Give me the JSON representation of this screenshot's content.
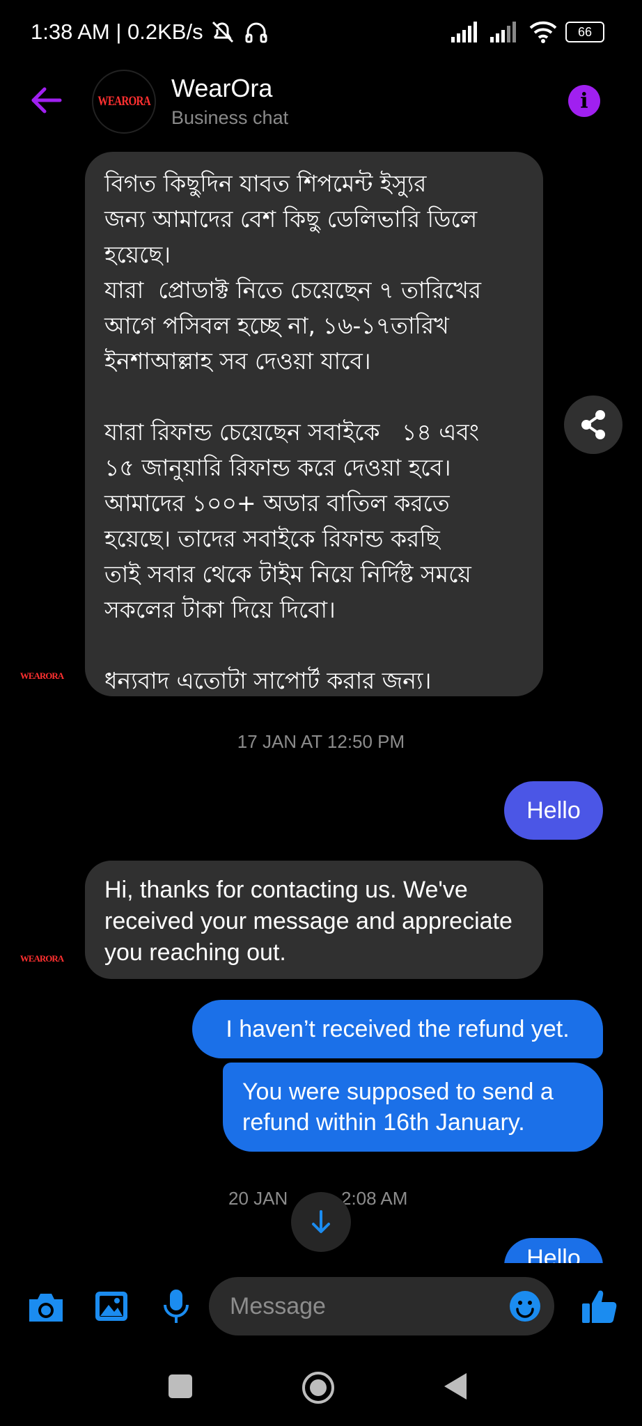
{
  "status_bar": {
    "time": "1:38 AM | 0.2KB/s",
    "battery": "66"
  },
  "header": {
    "title": "WearOra",
    "subtitle": "Business chat",
    "avatar_logo_text": "WEARORA"
  },
  "messages": {
    "bengali_notice": "বিগত কিছুদিন যাবত শিপমেন্ট ইস্যুর\nজন্য আমাদের বেশ কিছু ডেলিভারি ডিলে\nহয়েছে।\nযারা  প্রোডাক্ট নিতে চেয়েছেন ৭ তারিখের\nআগে পসিবল হচ্ছে না, ১৬-১৭তারিখ\nইনশাআল্লাহ সব দেওয়া যাবে।\n\nযারা রিফান্ড চেয়েছেন সবাইকে   ১৪ এবং\n১৫ জানুয়ারি রিফান্ড করে দেওয়া হবে।\nআমাদের ১০০+ অডার বাতিল করতে\nহয়েছে। তাদের সবাইকে রিফান্ড করছি\nতাই সবার থেকে টাইম নিয়ে নির্দিষ্ট সময়ে\nসকলের টাকা দিয়ে দিবো।\n\nধন্যবাদ এতোটা সাপোর্ট করার জন্য।",
    "timestamp_1": "17 JAN AT 12:50 PM",
    "outgoing_hello_1": "Hello",
    "auto_reply": "Hi, thanks for contacting us. We've received your message and appreciate you reaching out.",
    "outgoing_refund_1": "I haven’t received the refund yet.",
    "outgoing_refund_2": "You were supposed to send a refund within 16th January.",
    "timestamp_2_left": "20 JAN",
    "timestamp_2_right": "2:08 AM",
    "outgoing_hello_2": "Hello",
    "sender_logo_text": "WEARORA"
  },
  "composer": {
    "placeholder": "Message"
  },
  "colors": {
    "accent_purple": "#a020f0",
    "outgoing_blue": "#1b70e8",
    "outgoing_indigo": "#4b56e6",
    "incoming_gray": "#303030",
    "icon_blue": "#1b8cf0"
  }
}
